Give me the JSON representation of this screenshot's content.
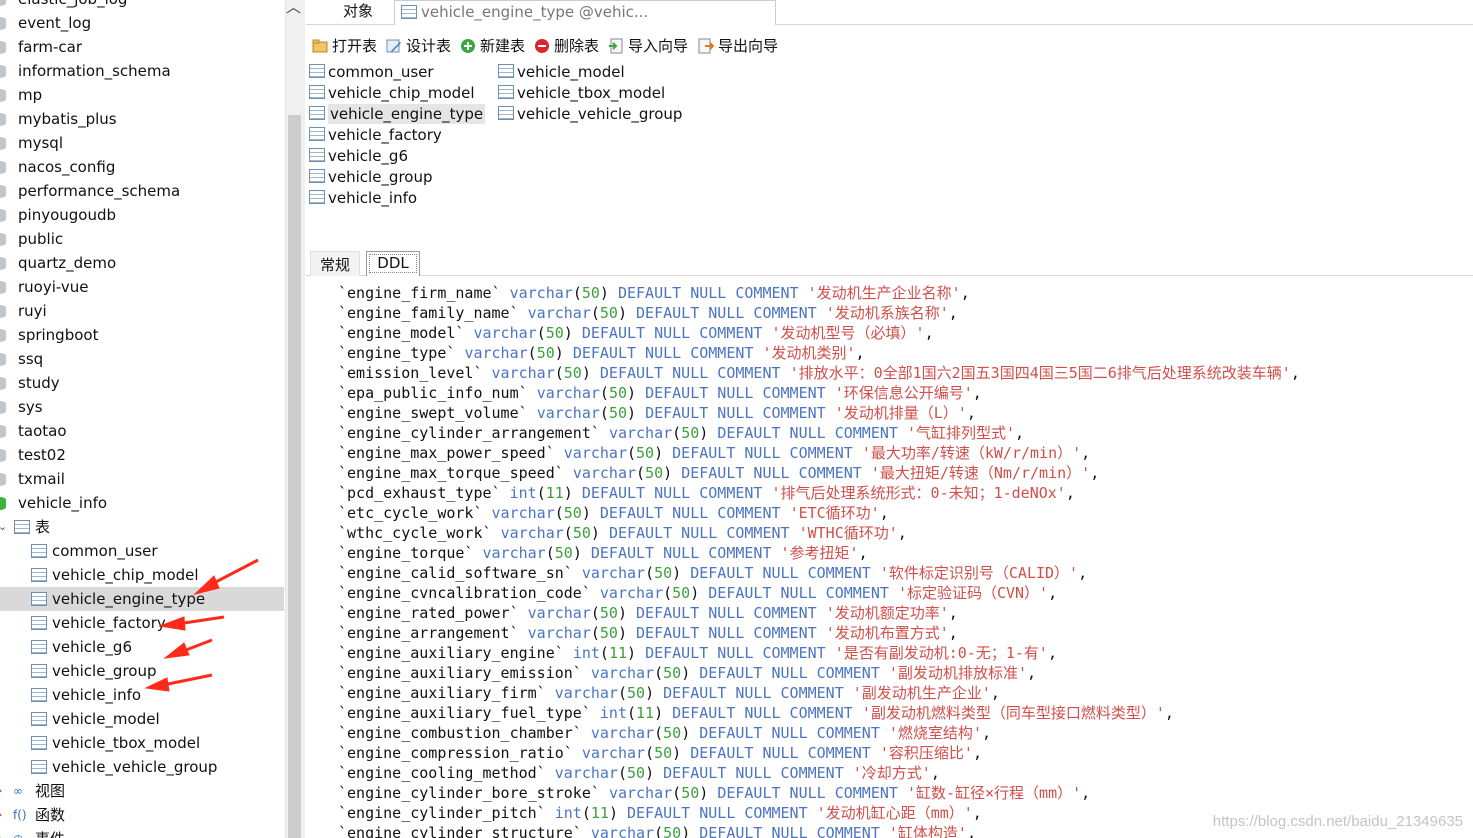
{
  "sidebar": {
    "partial_top": "elastic_job_log",
    "databases": [
      "event_log",
      "farm-car",
      "information_schema",
      "mp",
      "mybatis_plus",
      "mysql",
      "nacos_config",
      "performance_schema",
      "pinyougoudb",
      "public",
      "quartz_demo",
      "ruoyi-vue",
      "ruyi",
      "springboot",
      "ssq",
      "study",
      "sys",
      "taotao",
      "test02",
      "txmail",
      "vehicle_info"
    ],
    "tables_folder": "表",
    "tables": [
      "common_user",
      "vehicle_chip_model",
      "vehicle_engine_type",
      "vehicle_factory",
      "vehicle_g6",
      "vehicle_group",
      "vehicle_info",
      "vehicle_model",
      "vehicle_tbox_model",
      "vehicle_vehicle_group"
    ],
    "views_folder": "视图",
    "functions_folder": "函数",
    "events_folder": "事件"
  },
  "tabs": {
    "objects": "对象",
    "active": "vehicle_engine_type @vehic..."
  },
  "toolbar": {
    "open": "打开表",
    "design": "设计表",
    "new": "新建表",
    "delete": "删除表",
    "import": "导入向导",
    "export": "导出向导"
  },
  "object_list": {
    "col1": [
      "common_user",
      "vehicle_chip_model",
      "vehicle_engine_type",
      "vehicle_factory",
      "vehicle_g6",
      "vehicle_group",
      "vehicle_info"
    ],
    "col2": [
      "vehicle_model",
      "vehicle_tbox_model",
      "vehicle_vehicle_group"
    ]
  },
  "info_tabs": {
    "general": "常规",
    "ddl": "DDL"
  },
  "ddl_lines": [
    {
      "col": "engine_firm_name",
      "type": "varchar",
      "len": "50",
      "comment": "发动机生产企业名称"
    },
    {
      "col": "engine_family_name",
      "type": "varchar",
      "len": "50",
      "comment": "发动机系族名称"
    },
    {
      "col": "engine_model",
      "type": "varchar",
      "len": "50",
      "comment": "发动机型号（必填）"
    },
    {
      "col": "engine_type",
      "type": "varchar",
      "len": "50",
      "comment": "发动机类别"
    },
    {
      "col": "emission_level",
      "type": "varchar",
      "len": "50",
      "comment": "排放水平：0全部1国六2国五3国四4国三5国二6排气后处理系统改装车辆"
    },
    {
      "col": "epa_public_info_num",
      "type": "varchar",
      "len": "50",
      "comment": "环保信息公开编号"
    },
    {
      "col": "engine_swept_volume",
      "type": "varchar",
      "len": "50",
      "comment": "发动机排量（L）"
    },
    {
      "col": "engine_cylinder_arrangement",
      "type": "varchar",
      "len": "50",
      "comment": "气缸排列型式"
    },
    {
      "col": "engine_max_power_speed",
      "type": "varchar",
      "len": "50",
      "comment": "最大功率/转速（kW/r/min）"
    },
    {
      "col": "engine_max_torque_speed",
      "type": "varchar",
      "len": "50",
      "comment": "最大扭矩/转速（Nm/r/min）"
    },
    {
      "col": "pcd_exhaust_type",
      "type": "int",
      "len": "11",
      "comment": "排气后处理系统形式：0-未知；1-deNOx"
    },
    {
      "col": "etc_cycle_work",
      "type": "varchar",
      "len": "50",
      "comment": "ETC循环功"
    },
    {
      "col": "wthc_cycle_work",
      "type": "varchar",
      "len": "50",
      "comment": "WTHC循环功"
    },
    {
      "col": "engine_torque",
      "type": "varchar",
      "len": "50",
      "comment": "参考扭矩"
    },
    {
      "col": "engine_calid_software_sn",
      "type": "varchar",
      "len": "50",
      "comment": "软件标定识别号（CALID）"
    },
    {
      "col": "engine_cvncalibration_code",
      "type": "varchar",
      "len": "50",
      "comment": "标定验证码（CVN）"
    },
    {
      "col": "engine_rated_power",
      "type": "varchar",
      "len": "50",
      "comment": "发动机额定功率"
    },
    {
      "col": "engine_arrangement",
      "type": "varchar",
      "len": "50",
      "comment": "发动机布置方式"
    },
    {
      "col": "engine_auxiliary_engine",
      "type": "int",
      "len": "11",
      "comment": "是否有副发动机:0-无；1-有"
    },
    {
      "col": "engine_auxiliary_emission",
      "type": "varchar",
      "len": "50",
      "comment": "副发动机排放标准"
    },
    {
      "col": "engine_auxiliary_firm",
      "type": "varchar",
      "len": "50",
      "comment": "副发动机生产企业"
    },
    {
      "col": "engine_auxiliary_fuel_type",
      "type": "int",
      "len": "11",
      "comment": "副发动机燃料类型（同车型接口燃料类型）"
    },
    {
      "col": "engine_combustion_chamber",
      "type": "varchar",
      "len": "50",
      "comment": "燃烧室结构"
    },
    {
      "col": "engine_compression_ratio",
      "type": "varchar",
      "len": "50",
      "comment": "容积压缩比"
    },
    {
      "col": "engine_cooling_method",
      "type": "varchar",
      "len": "50",
      "comment": "冷却方式"
    },
    {
      "col": "engine_cylinder_bore_stroke",
      "type": "varchar",
      "len": "50",
      "comment": "缸数-缸径×行程（mm）"
    },
    {
      "col": "engine_cylinder_pitch",
      "type": "int",
      "len": "11",
      "comment": "发动机缸心距（mm）"
    },
    {
      "col": "engine_cylinder_structure",
      "type": "varchar",
      "len": "50",
      "comment": "缸体构造"
    }
  ],
  "ddl_keywords": {
    "default": "DEFAULT",
    "null": "NULL",
    "comment": "COMMENT"
  },
  "watermark": "https://blog.csdn.net/baidu_21349635",
  "colors": {
    "keyword": "#4b74c2",
    "number": "#3da03a",
    "string": "#d04f4a",
    "arrow": "#ff2a1a",
    "selection": "#d9d9d9"
  }
}
